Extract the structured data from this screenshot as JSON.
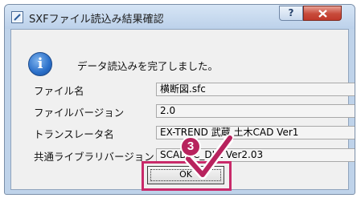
{
  "window": {
    "title": "SXFファイル読込み結果確認",
    "help_label": "?"
  },
  "message": "データ読込みを完了しました。",
  "fields": [
    {
      "label": "ファイル名",
      "value": "横断図.sfc"
    },
    {
      "label": "ファイルバージョン",
      "value": "2.0"
    },
    {
      "label": "トランスレータ名",
      "value": "EX-TREND 武蔵 土木CAD Ver1"
    },
    {
      "label": "共通ライブラリバージョン",
      "value": "SCADEC_DLL Ver2.03"
    }
  ],
  "ok_button": {
    "label": "OK"
  },
  "annotation": {
    "step_number": "3",
    "color": "#b8235e"
  },
  "colors": {
    "close_button": "#c74a3a",
    "highlight": "#c92a6a",
    "info_icon": "#2a6fc9"
  }
}
